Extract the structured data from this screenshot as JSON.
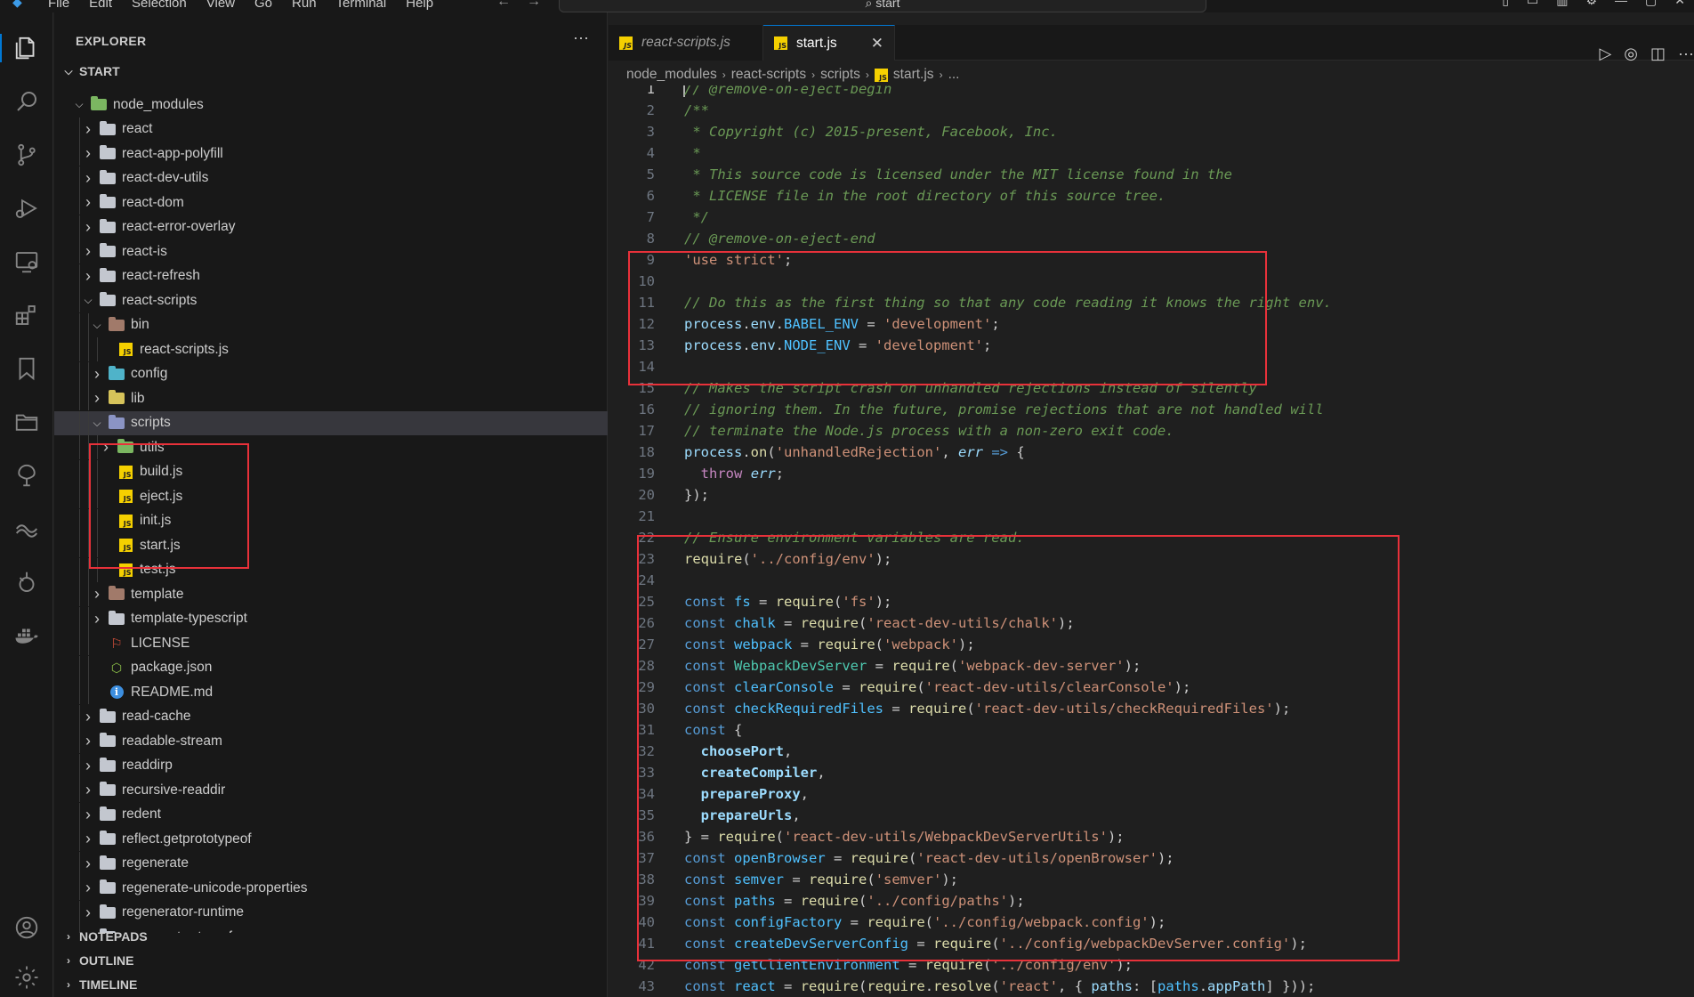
{
  "menu": [
    "File",
    "Edit",
    "Selection",
    "View",
    "Go",
    "Run",
    "Terminal",
    "Help"
  ],
  "search": {
    "text": "start"
  },
  "sidebar": {
    "title": "EXPLORER",
    "root": "START",
    "rows": [
      {
        "label": "node_modules",
        "depth": 0,
        "twisty": "open",
        "icon": "folder-green"
      },
      {
        "label": "react",
        "depth": 1,
        "twisty": "closed",
        "icon": "folder"
      },
      {
        "label": "react-app-polyfill",
        "depth": 1,
        "twisty": "closed",
        "icon": "folder"
      },
      {
        "label": "react-dev-utils",
        "depth": 1,
        "twisty": "closed",
        "icon": "folder"
      },
      {
        "label": "react-dom",
        "depth": 1,
        "twisty": "closed",
        "icon": "folder"
      },
      {
        "label": "react-error-overlay",
        "depth": 1,
        "twisty": "closed",
        "icon": "folder"
      },
      {
        "label": "react-is",
        "depth": 1,
        "twisty": "closed",
        "icon": "folder"
      },
      {
        "label": "react-refresh",
        "depth": 1,
        "twisty": "closed",
        "icon": "folder"
      },
      {
        "label": "react-scripts",
        "depth": 1,
        "twisty": "open",
        "icon": "folder"
      },
      {
        "label": "bin",
        "depth": 2,
        "twisty": "open",
        "icon": "folder-brown"
      },
      {
        "label": "react-scripts.js",
        "depth": 3,
        "twisty": "none",
        "icon": "js"
      },
      {
        "label": "config",
        "depth": 2,
        "twisty": "closed",
        "icon": "folder-teal"
      },
      {
        "label": "lib",
        "depth": 2,
        "twisty": "closed",
        "icon": "folder-yellow"
      },
      {
        "label": "scripts",
        "depth": 2,
        "twisty": "open",
        "icon": "folder-slate",
        "selected": true
      },
      {
        "label": "utils",
        "depth": 3,
        "twisty": "closed",
        "icon": "folder-green"
      },
      {
        "label": "build.js",
        "depth": 3,
        "twisty": "none",
        "icon": "js"
      },
      {
        "label": "eject.js",
        "depth": 3,
        "twisty": "none",
        "icon": "js"
      },
      {
        "label": "init.js",
        "depth": 3,
        "twisty": "none",
        "icon": "js"
      },
      {
        "label": "start.js",
        "depth": 3,
        "twisty": "none",
        "icon": "js"
      },
      {
        "label": "test.js",
        "depth": 3,
        "twisty": "none",
        "icon": "js"
      },
      {
        "label": "template",
        "depth": 2,
        "twisty": "closed",
        "icon": "folder-brown"
      },
      {
        "label": "template-typescript",
        "depth": 2,
        "twisty": "closed",
        "icon": "folder"
      },
      {
        "label": "LICENSE",
        "depth": 2,
        "twisty": "none",
        "icon": "license"
      },
      {
        "label": "package.json",
        "depth": 2,
        "twisty": "none",
        "icon": "package"
      },
      {
        "label": "README.md",
        "depth": 2,
        "twisty": "none",
        "icon": "info"
      },
      {
        "label": "read-cache",
        "depth": 1,
        "twisty": "closed",
        "icon": "folder"
      },
      {
        "label": "readable-stream",
        "depth": 1,
        "twisty": "closed",
        "icon": "folder"
      },
      {
        "label": "readdirp",
        "depth": 1,
        "twisty": "closed",
        "icon": "folder"
      },
      {
        "label": "recursive-readdir",
        "depth": 1,
        "twisty": "closed",
        "icon": "folder"
      },
      {
        "label": "redent",
        "depth": 1,
        "twisty": "closed",
        "icon": "folder"
      },
      {
        "label": "reflect.getprototypeof",
        "depth": 1,
        "twisty": "closed",
        "icon": "folder"
      },
      {
        "label": "regenerate",
        "depth": 1,
        "twisty": "closed",
        "icon": "folder"
      },
      {
        "label": "regenerate-unicode-properties",
        "depth": 1,
        "twisty": "closed",
        "icon": "folder"
      },
      {
        "label": "regenerator-runtime",
        "depth": 1,
        "twisty": "closed",
        "icon": "folder"
      },
      {
        "label": "regenerator-transform",
        "depth": 1,
        "twisty": "closed",
        "icon": "folder"
      }
    ],
    "sections": [
      "NOTEPADS",
      "OUTLINE",
      "TIMELINE"
    ]
  },
  "tabs": [
    {
      "label": "react-scripts.js",
      "active": false
    },
    {
      "label": "start.js",
      "active": true
    }
  ],
  "breadcrumb": [
    "node_modules",
    "react-scripts",
    "scripts",
    "start.js",
    "..."
  ],
  "editor": {
    "lines": [
      [
        [
          "c",
          "// @remove-on-eject-begin"
        ]
      ],
      [
        [
          "c",
          "/**"
        ]
      ],
      [
        [
          "c",
          " * Copyright (c) 2015-present, Facebook, Inc."
        ]
      ],
      [
        [
          "c",
          " *"
        ]
      ],
      [
        [
          "c",
          " * This source code is licensed under the MIT license found in the"
        ]
      ],
      [
        [
          "c",
          " * LICENSE file in the root directory of this source tree."
        ]
      ],
      [
        [
          "c",
          " */"
        ]
      ],
      [
        [
          "c",
          "// @remove-on-eject-end"
        ]
      ],
      [
        [
          "str",
          "'use strict'"
        ],
        [
          "p",
          ";"
        ]
      ],
      [],
      [
        [
          "c",
          "// Do this as the first thing so that any code reading it knows the right env."
        ]
      ],
      [
        [
          "var",
          "process"
        ],
        [
          "p",
          "."
        ],
        [
          "var",
          "env"
        ],
        [
          "p",
          "."
        ],
        [
          "cst",
          "BABEL_ENV"
        ],
        [
          "p",
          " = "
        ],
        [
          "str",
          "'development'"
        ],
        [
          "p",
          ";"
        ]
      ],
      [
        [
          "var",
          "process"
        ],
        [
          "p",
          "."
        ],
        [
          "var",
          "env"
        ],
        [
          "p",
          "."
        ],
        [
          "cst",
          "NODE_ENV"
        ],
        [
          "p",
          " = "
        ],
        [
          "str",
          "'development'"
        ],
        [
          "p",
          ";"
        ]
      ],
      [],
      [
        [
          "c",
          "// Makes the script crash on unhandled rejections instead of silently"
        ]
      ],
      [
        [
          "c",
          "// ignoring them. In the future, promise rejections that are not handled will"
        ]
      ],
      [
        [
          "c",
          "// terminate the Node.js process with a non-zero exit code."
        ]
      ],
      [
        [
          "var",
          "process"
        ],
        [
          "p",
          "."
        ],
        [
          "fn",
          "on"
        ],
        [
          "p",
          "("
        ],
        [
          "str",
          "'unhandledRejection'"
        ],
        [
          "p",
          ", "
        ],
        [
          "var it",
          "err"
        ],
        [
          "p",
          " "
        ],
        [
          "kw",
          "=>"
        ],
        [
          "p",
          " {"
        ]
      ],
      [
        [
          "p",
          "  "
        ],
        [
          "kw2",
          "throw"
        ],
        [
          "p",
          " "
        ],
        [
          "var it",
          "err"
        ],
        [
          "p",
          ";"
        ]
      ],
      [
        [
          "p",
          "});"
        ]
      ],
      [],
      [
        [
          "c",
          "// Ensure environment variables are read."
        ]
      ],
      [
        [
          "fn",
          "require"
        ],
        [
          "p",
          "("
        ],
        [
          "str",
          "'../config/env'"
        ],
        [
          "p",
          ");"
        ]
      ],
      [],
      [
        [
          "kw",
          "const"
        ],
        [
          "p",
          " "
        ],
        [
          "cst",
          "fs"
        ],
        [
          "p",
          " = "
        ],
        [
          "fn",
          "require"
        ],
        [
          "p",
          "("
        ],
        [
          "str",
          "'fs'"
        ],
        [
          "p",
          ");"
        ]
      ],
      [
        [
          "kw",
          "const"
        ],
        [
          "p",
          " "
        ],
        [
          "cst",
          "chalk"
        ],
        [
          "p",
          " = "
        ],
        [
          "fn",
          "require"
        ],
        [
          "p",
          "("
        ],
        [
          "str",
          "'react-dev-utils/chalk'"
        ],
        [
          "p",
          ");"
        ]
      ],
      [
        [
          "kw",
          "const"
        ],
        [
          "p",
          " "
        ],
        [
          "cst",
          "webpack"
        ],
        [
          "p",
          " = "
        ],
        [
          "fn",
          "require"
        ],
        [
          "p",
          "("
        ],
        [
          "str",
          "'webpack'"
        ],
        [
          "p",
          ");"
        ]
      ],
      [
        [
          "kw",
          "const"
        ],
        [
          "p",
          " "
        ],
        [
          "cls",
          "WebpackDevServer"
        ],
        [
          "p",
          " = "
        ],
        [
          "fn",
          "require"
        ],
        [
          "p",
          "("
        ],
        [
          "str",
          "'webpack-dev-server'"
        ],
        [
          "p",
          ");"
        ]
      ],
      [
        [
          "kw",
          "const"
        ],
        [
          "p",
          " "
        ],
        [
          "cst",
          "clearConsole"
        ],
        [
          "p",
          " = "
        ],
        [
          "fn",
          "require"
        ],
        [
          "p",
          "("
        ],
        [
          "str",
          "'react-dev-utils/clearConsole'"
        ],
        [
          "p",
          ");"
        ]
      ],
      [
        [
          "kw",
          "const"
        ],
        [
          "p",
          " "
        ],
        [
          "cst",
          "checkRequiredFiles"
        ],
        [
          "p",
          " = "
        ],
        [
          "fn",
          "require"
        ],
        [
          "p",
          "("
        ],
        [
          "str",
          "'react-dev-utils/checkRequiredFiles'"
        ],
        [
          "p",
          ");"
        ]
      ],
      [
        [
          "kw",
          "const"
        ],
        [
          "p",
          " {"
        ]
      ],
      [
        [
          "p",
          "  "
        ],
        [
          "prop",
          "choosePort"
        ],
        [
          "p",
          ","
        ]
      ],
      [
        [
          "p",
          "  "
        ],
        [
          "prop",
          "createCompiler"
        ],
        [
          "p",
          ","
        ]
      ],
      [
        [
          "p",
          "  "
        ],
        [
          "prop",
          "prepareProxy"
        ],
        [
          "p",
          ","
        ]
      ],
      [
        [
          "p",
          "  "
        ],
        [
          "prop",
          "prepareUrls"
        ],
        [
          "p",
          ","
        ]
      ],
      [
        [
          "p",
          "} = "
        ],
        [
          "fn",
          "require"
        ],
        [
          "p",
          "("
        ],
        [
          "str",
          "'react-dev-utils/WebpackDevServerUtils'"
        ],
        [
          "p",
          ");"
        ]
      ],
      [
        [
          "kw",
          "const"
        ],
        [
          "p",
          " "
        ],
        [
          "cst",
          "openBrowser"
        ],
        [
          "p",
          " = "
        ],
        [
          "fn",
          "require"
        ],
        [
          "p",
          "("
        ],
        [
          "str",
          "'react-dev-utils/openBrowser'"
        ],
        [
          "p",
          ");"
        ]
      ],
      [
        [
          "kw",
          "const"
        ],
        [
          "p",
          " "
        ],
        [
          "cst",
          "semver"
        ],
        [
          "p",
          " = "
        ],
        [
          "fn",
          "require"
        ],
        [
          "p",
          "("
        ],
        [
          "str",
          "'semver'"
        ],
        [
          "p",
          ");"
        ]
      ],
      [
        [
          "kw",
          "const"
        ],
        [
          "p",
          " "
        ],
        [
          "cst",
          "paths"
        ],
        [
          "p",
          " = "
        ],
        [
          "fn",
          "require"
        ],
        [
          "p",
          "("
        ],
        [
          "str",
          "'../config/paths'"
        ],
        [
          "p",
          ");"
        ]
      ],
      [
        [
          "kw",
          "const"
        ],
        [
          "p",
          " "
        ],
        [
          "cst",
          "configFactory"
        ],
        [
          "p",
          " = "
        ],
        [
          "fn",
          "require"
        ],
        [
          "p",
          "("
        ],
        [
          "str",
          "'../config/webpack.config'"
        ],
        [
          "p",
          ");"
        ]
      ],
      [
        [
          "kw",
          "const"
        ],
        [
          "p",
          " "
        ],
        [
          "cst",
          "createDevServerConfig"
        ],
        [
          "p",
          " = "
        ],
        [
          "fn",
          "require"
        ],
        [
          "p",
          "("
        ],
        [
          "str",
          "'../config/webpackDevServer.config'"
        ],
        [
          "p",
          ");"
        ]
      ],
      [
        [
          "kw",
          "const"
        ],
        [
          "p",
          " "
        ],
        [
          "cst",
          "getClientEnvironment"
        ],
        [
          "p",
          " = "
        ],
        [
          "fn",
          "require"
        ],
        [
          "p",
          "("
        ],
        [
          "str",
          "'../config/env'"
        ],
        [
          "p",
          ");"
        ]
      ],
      [
        [
          "kw",
          "const"
        ],
        [
          "p",
          " "
        ],
        [
          "cst",
          "react"
        ],
        [
          "p",
          " = "
        ],
        [
          "fn",
          "require"
        ],
        [
          "p",
          "("
        ],
        [
          "fn",
          "require"
        ],
        [
          "p",
          "."
        ],
        [
          "fn",
          "resolve"
        ],
        [
          "p",
          "("
        ],
        [
          "str",
          "'react'"
        ],
        [
          "p",
          ", { "
        ],
        [
          "var",
          "paths"
        ],
        [
          "p",
          ": ["
        ],
        [
          "cst",
          "paths"
        ],
        [
          "p",
          "."
        ],
        [
          "var",
          "appPath"
        ],
        [
          "p",
          "] }));"
        ]
      ]
    ]
  }
}
